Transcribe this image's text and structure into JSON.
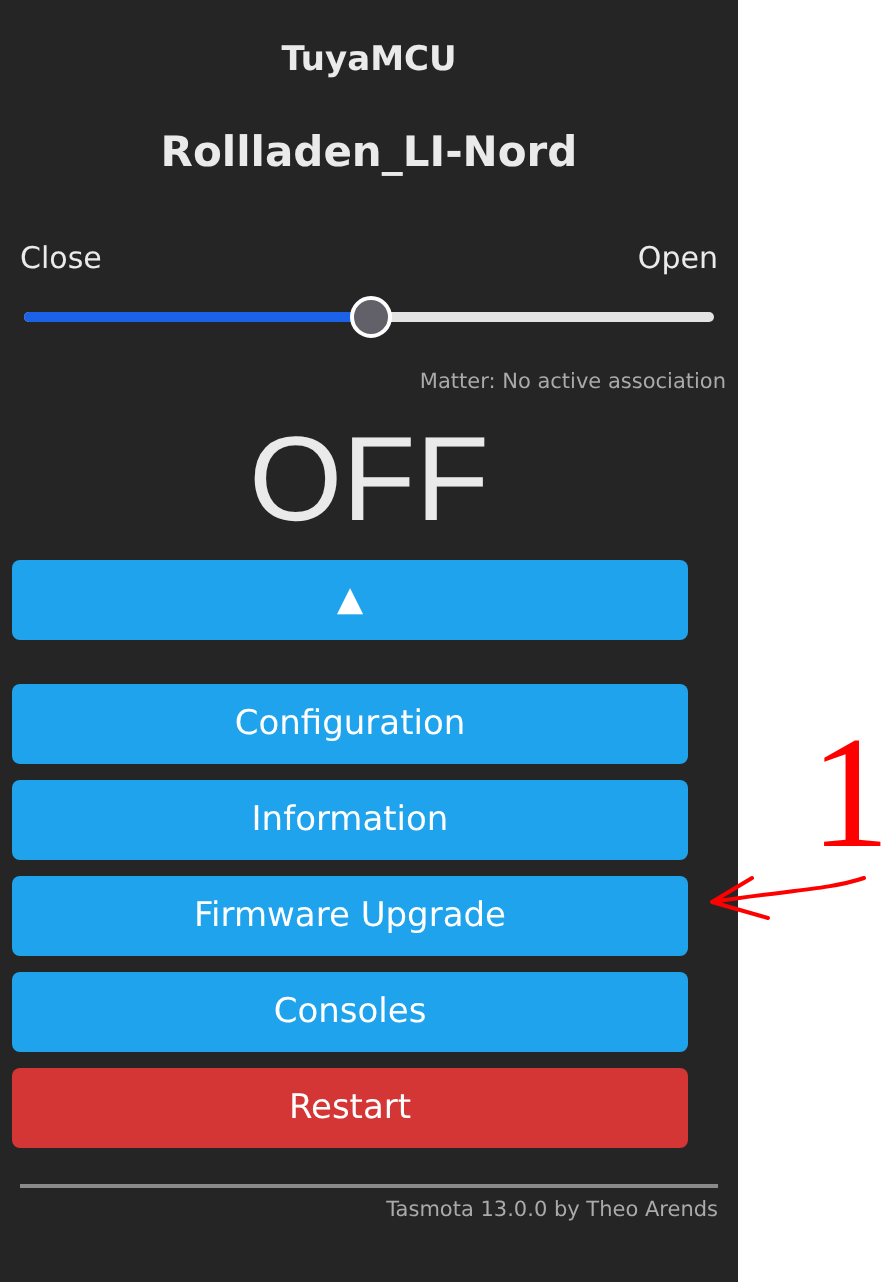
{
  "header": {
    "module": "TuyaMCU",
    "device_name": "Rollladen_LI-Nord"
  },
  "slider": {
    "min_label": "Close",
    "max_label": "Open",
    "level": 0.5
  },
  "matter_status": "Matter: No active association",
  "power_state": "OFF",
  "control_buttons": [
    {
      "label": "▲",
      "kind": "primary"
    }
  ],
  "menu_buttons": [
    {
      "label": "Configuration",
      "kind": "primary"
    },
    {
      "label": "Information",
      "kind": "primary"
    },
    {
      "label": "Firmware Upgrade",
      "kind": "primary"
    },
    {
      "label": "Consoles",
      "kind": "primary"
    },
    {
      "label": "Restart",
      "kind": "danger"
    }
  ],
  "footer": "Tasmota 13.0.0 by Theo Arends",
  "annotation": {
    "label": "1"
  }
}
